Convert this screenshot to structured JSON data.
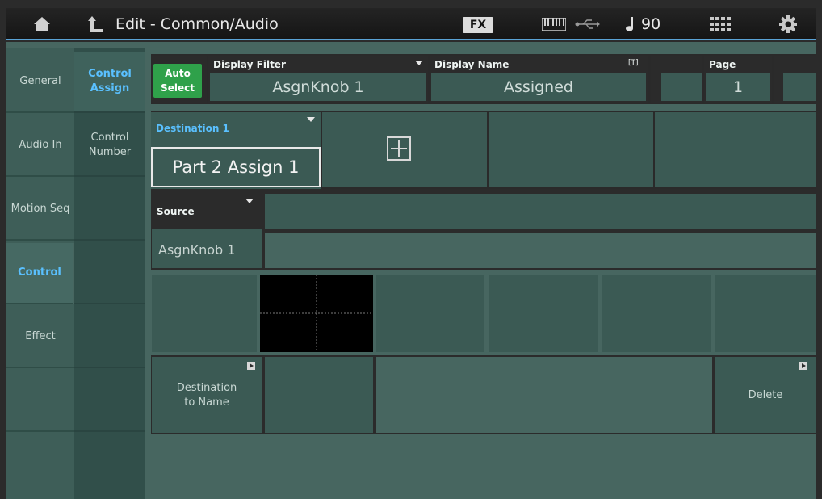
{
  "header": {
    "title": "Edit - Common/Audio",
    "fx_label": "FX",
    "tempo": "90"
  },
  "tabs": [
    {
      "label": "General",
      "active": false
    },
    {
      "label": "Audio In",
      "active": false
    },
    {
      "label": "Motion Seq",
      "active": false
    },
    {
      "label": "Control",
      "active": true
    },
    {
      "label": "Effect",
      "active": false
    }
  ],
  "subtabs": [
    {
      "label": "Control Assign",
      "active": true
    },
    {
      "label": "Control Number",
      "active": false
    }
  ],
  "toolbar": {
    "auto_select_line1": "Auto",
    "auto_select_line2": "Select",
    "display_filter_label": "Display Filter",
    "display_filter_value": "AsgnKnob 1",
    "display_name_label": "Display Name",
    "display_name_value": "Assigned",
    "text_icon": "[T]",
    "page_label": "Page",
    "page_value": "1"
  },
  "destination": {
    "label": "Destination 1",
    "value": "Part 2 Assign 1"
  },
  "source": {
    "label": "Source",
    "value": "AsgnKnob 1"
  },
  "bottom": {
    "dest_to_name_line1": "Destination",
    "dest_to_name_line2": "to Name",
    "delete_label": "Delete"
  },
  "icons": [
    "home-icon",
    "up-arrow-icon",
    "keyboard-icon",
    "usb-icon",
    "note-icon",
    "grid-icon",
    "gear-icon",
    "plus-icon"
  ]
}
